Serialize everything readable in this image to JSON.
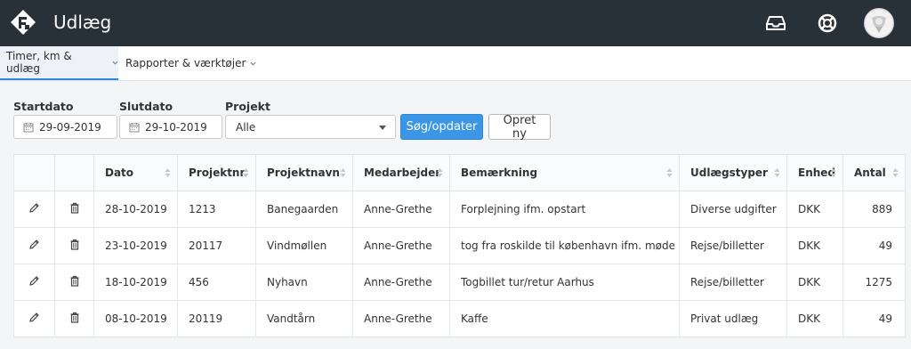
{
  "header": {
    "title": "Udlæg"
  },
  "nav": {
    "tabs": [
      {
        "label": "Timer, km & udlæg"
      },
      {
        "label": "Rapporter & værktøjer"
      }
    ]
  },
  "filters": {
    "start_label": "Startdato",
    "start_value": "29-09-2019",
    "end_label": "Slutdato",
    "end_value": "29-10-2019",
    "project_label": "Projekt",
    "project_value": "Alle"
  },
  "buttons": {
    "search": "Søg/opdater",
    "create": "Opret ny"
  },
  "table": {
    "columns": [
      "Dato",
      "Projektnr.",
      "Projektnavn",
      "Medarbejder",
      "Bemærkning",
      "Udlægstyper",
      "Enhed",
      "Antal"
    ],
    "rows": [
      [
        "28-10-2019",
        "1213",
        "Banegaarden",
        "Anne-Grethe",
        "Forplejning ifm. opstart",
        "Diverse udgifter",
        "DKK",
        "889"
      ],
      [
        "23-10-2019",
        "20117",
        "Vindmøllen",
        "Anne-Grethe",
        "tog fra roskilde til københavn ifm. møde",
        "Rejse/billetter",
        "DKK",
        "49"
      ],
      [
        "18-10-2019",
        "456",
        "Nyhavn",
        "Anne-Grethe",
        "Togbillet tur/retur Aarhus",
        "Rejse/billetter",
        "DKK",
        "1275"
      ],
      [
        "08-10-2019",
        "20119",
        "Vandtårn",
        "Anne-Grethe",
        "Kaffe",
        "Privat udlæg",
        "DKK",
        "49"
      ]
    ]
  },
  "colors": {
    "topbar": "#283038",
    "primary": "#3b97e6",
    "active_tab": "#2f88d8"
  },
  "icons": [
    "app-logo-icon",
    "inbox-icon",
    "help-lifebuoy-icon",
    "avatar",
    "chevron-down-icon",
    "calendar-icon",
    "sort-icon",
    "edit-pencil-icon",
    "delete-trash-icon"
  ]
}
